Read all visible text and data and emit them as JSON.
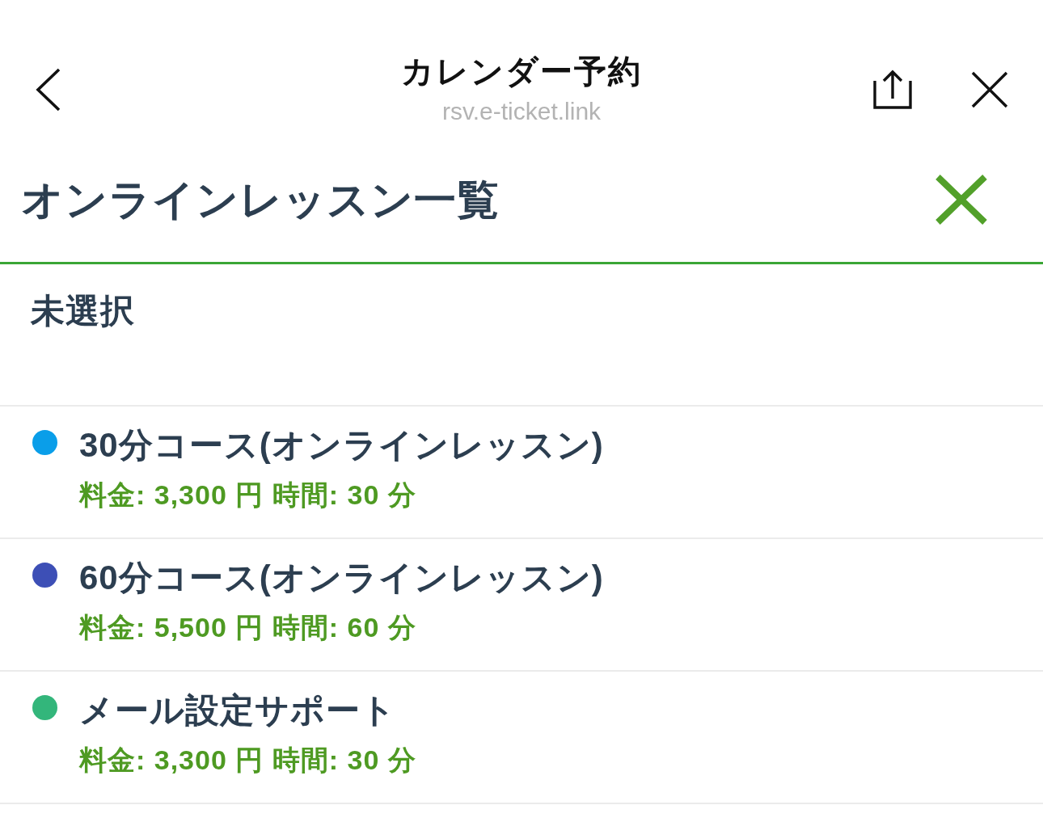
{
  "browser_bar": {
    "title": "カレンダー予約",
    "url": "rsv.e-ticket.link"
  },
  "panel": {
    "title": "オンラインレッスン一覧",
    "selection": "未選択"
  },
  "courses": [
    {
      "name": "30分コース(オンラインレッスン)",
      "details": "料金: 3,300 円 時間: 30 分",
      "color": "#0a9ee9"
    },
    {
      "name": "60分コース(オンラインレッスン)",
      "details": "料金: 5,500 円 時間: 60 分",
      "color": "#3d4fb6"
    },
    {
      "name": "メール設定サポート",
      "details": "料金: 3,300 円 時間: 30 分",
      "color": "#33b67b"
    }
  ]
}
